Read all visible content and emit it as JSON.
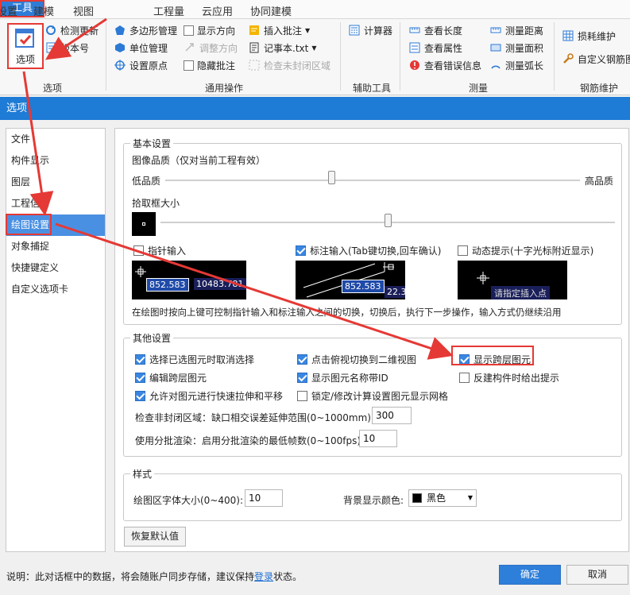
{
  "menubar": {
    "items": [
      "设置",
      "建模",
      "视图",
      "工具",
      "工程量",
      "云应用",
      "协同建模"
    ],
    "active": "工具"
  },
  "ribbon": {
    "options_label": "选项",
    "check_update": "检测更新",
    "version_no": "版本号",
    "group_options": "选项",
    "polygon_manage": "多边形管理",
    "unit_manage": "单位管理",
    "set_origin": "设置原点",
    "show_direction": "显示方向",
    "adjust_direction": "调整方向",
    "hide_annotation": "隐藏批注",
    "insert_annotation": "插入批注",
    "notepad": "记事本.txt",
    "check_unclosed": "检查未封闭区域",
    "group_common": "通用操作",
    "calculator": "计算器",
    "group_aux": "辅助工具",
    "view_length": "查看长度",
    "view_property": "查看属性",
    "view_errors": "查看错误信息",
    "measure_distance": "测量距离",
    "measure_area": "测量面积",
    "measure_arc": "测量弧长",
    "group_measure": "测量",
    "loss_maintain": "损耗维护",
    "custom_rebar": "自定义钢筋图",
    "group_rebar": "钢筋维护"
  },
  "dialog": {
    "title": "选项",
    "nav": [
      "文件",
      "构件显示",
      "图层",
      "工程信息",
      "绘图设置",
      "对象捕捉",
      "快捷键定义",
      "自定义选项卡"
    ],
    "active_nav": "绘图设置",
    "basic": {
      "legend": "基本设置",
      "image_quality_label": "图像品质（仅对当前工程有效）",
      "low_quality": "低品质",
      "high_quality": "高品质",
      "image_quality_value": 0.4,
      "pick_box_label": "拾取框大小",
      "pick_box_value": 0.5,
      "pointer_input": "指针输入",
      "pointer_input_checked": false,
      "dim_input": "标注输入(Tab键切换,回车确认)",
      "dim_input_checked": true,
      "dynamic_hint": "动态提示(十字光标附近显示)",
      "dynamic_hint_checked": false,
      "preview1_a": "852.583",
      "preview1_b": "10483.781",
      "preview2_a": "852.583",
      "preview2_b": "22.3",
      "preview3_hint": "请指定插入点",
      "desc": "在绘图时按向上键可控制指针输入和标注输入之间的切换，切换后，执行下一步操作，输入方式仍继续沿用"
    },
    "other": {
      "legend": "其他设置",
      "cb1": "选择已选图元时取消选择",
      "cb1_checked": true,
      "cb2": "点击俯视切换到二维视图",
      "cb2_checked": true,
      "cb3": "显示跨层图元",
      "cb3_checked": true,
      "cb4": "编辑跨层图元",
      "cb4_checked": true,
      "cb5": "显示图元名称带ID",
      "cb5_checked": true,
      "cb6": "反建构件时给出提示",
      "cb6_checked": false,
      "cb7": "允许对图元进行快速拉伸和平移",
      "cb7_checked": true,
      "cb8": "锁定/修改计算设置图元显示网格",
      "cb8_checked": false,
      "gap_label": "检查非封闭区域：缺口相交误差延伸范围(0~1000mm):",
      "gap_value": "300",
      "batch_label": "使用分批渲染：启用分批渲染的最低帧数(0~100fps):",
      "batch_value": "10"
    },
    "style": {
      "legend": "样式",
      "font_size_label": "绘图区字体大小(0~400):",
      "font_size_value": "10",
      "bg_color_label": "背景显示颜色:",
      "bg_color_value": "黑色",
      "bg_color_swatch": "#000000"
    },
    "restore_default": "恢复默认值",
    "footer_note_prefix": "说明：此对话框中的数据，将会随账户同步存储，建议保持",
    "footer_note_link": "登录",
    "footer_note_suffix": "状态。",
    "ok": "确定",
    "cancel": "取消"
  },
  "colors": {
    "accent": "#1e7bd6",
    "highlight": "#e53935",
    "selected_nav": "#4a90e2"
  }
}
